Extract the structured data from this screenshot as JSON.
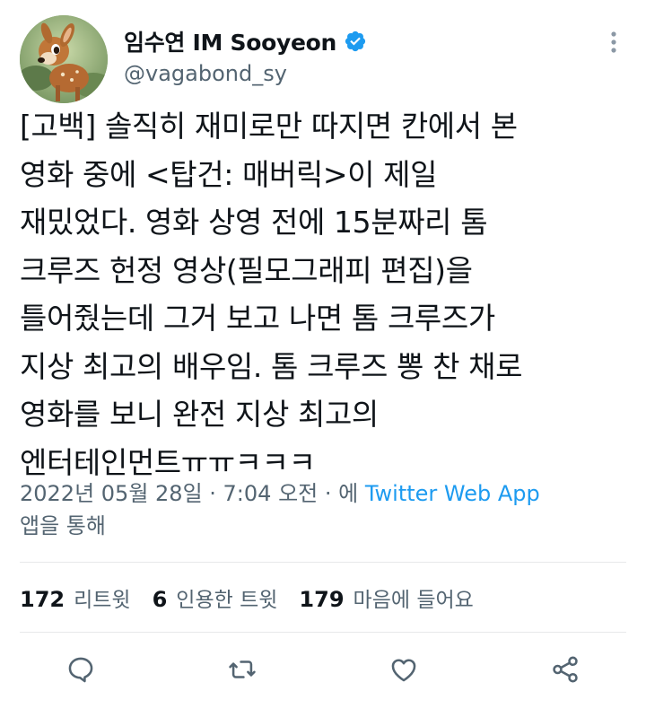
{
  "user": {
    "display_name": "임수연 IM Sooyeon",
    "handle": "@vagabond_sy",
    "verified": true,
    "avatar_icon": "bambi-avatar"
  },
  "tweet": {
    "text": "[고백] 솔직히 재미로만 따지면 칸에서 본\n영화 중에 <탑건: 매버릭>이 제일\n재밌었다. 영화 상영 전에 15분짜리 톰\n크루즈 헌정 영상(필모그래피 편집)을\n틀어줬는데 그거 보고 나면 톰 크루즈가\n지상 최고의 배우임. 톰 크루즈 뽕 찬 채로\n영화를 보니 완전 지상 최고의\n엔터테인먼트ㅠㅠㅋㅋㅋ",
    "timestamp": "2022년 05월 28일 · 7:04 오전 · 에",
    "source": "Twitter Web App",
    "source_suffix": "앱을 통해"
  },
  "stats": {
    "retweets_count": "172",
    "retweets_label": "리트윗",
    "quotes_count": "6",
    "quotes_label": "인용한 트윗",
    "likes_count": "179",
    "likes_label": "마음에 들어요"
  },
  "colors": {
    "text": "#0f1419",
    "secondary": "#536471",
    "link": "#1d9bf0",
    "divider": "#e7e9ea"
  },
  "icons": {
    "more": "more-dots-icon",
    "reply": "reply-icon",
    "retweet": "retweet-icon",
    "like": "heart-icon",
    "share": "share-icon"
  }
}
